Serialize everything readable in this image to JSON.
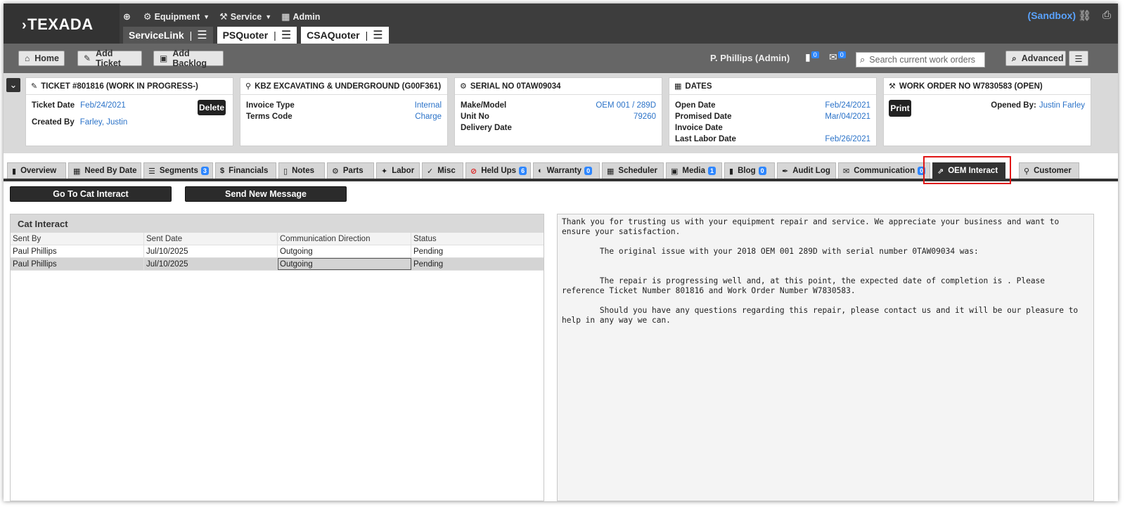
{
  "app": {
    "logo": "TEXADA",
    "topmenu": {
      "equipment": "Equipment",
      "service": "Service",
      "admin": "Admin"
    },
    "app_tabs": [
      {
        "label": "ServiceLink"
      },
      {
        "label": "PSQuoter"
      },
      {
        "label": "CSAQuoter"
      }
    ],
    "sandbox": "(Sandbox)"
  },
  "toolbar": {
    "home": "Home",
    "add_ticket": "Add Ticket",
    "add_backlog": "Add Backlog",
    "user": "P. Phillips (Admin)",
    "badge1": "0",
    "badge2": "0",
    "search_placeholder": "Search current work orders",
    "advanced": "Advanced"
  },
  "ticket": {
    "title": "TICKET #801816 (WORK IN PROGRESS-)",
    "ticket_date_label": "Ticket Date",
    "ticket_date": "Feb/24/2021",
    "created_by_label": "Created By",
    "created_by": "Farley, Justin",
    "delete": "Delete"
  },
  "customer": {
    "title": "KBZ EXCAVATING & UNDERGROUND (G00F361)",
    "invoice_type_label": "Invoice Type",
    "invoice_type": "Internal",
    "terms_code_label": "Terms Code",
    "terms_code": "Charge"
  },
  "serial": {
    "title": "SERIAL NO 0TAW09034",
    "make_model_label": "Make/Model",
    "make_model": "OEM 001 / 289D",
    "unit_no_label": "Unit No",
    "unit_no": "79260",
    "delivery_date_label": "Delivery Date"
  },
  "dates": {
    "title": "DATES",
    "open_date_label": "Open Date",
    "open_date": "Feb/24/2021",
    "promised_date_label": "Promised Date",
    "promised_date": "Mar/04/2021",
    "invoice_date_label": "Invoice Date",
    "last_labor_date_label": "Last Labor Date",
    "last_labor_date": "Feb/26/2021"
  },
  "work_order": {
    "title": "WORK ORDER NO W7830583 (OPEN)",
    "print": "Print",
    "opened_by_label": "Opened By:",
    "opened_by": "Justin Farley"
  },
  "tabs": [
    {
      "label": "Overview"
    },
    {
      "label": "Need By Date"
    },
    {
      "label": "Segments",
      "badge": "3"
    },
    {
      "label": "Financials"
    },
    {
      "label": "Notes"
    },
    {
      "label": "Parts"
    },
    {
      "label": "Labor"
    },
    {
      "label": "Misc"
    },
    {
      "label": "Held Ups",
      "badge": "6"
    },
    {
      "label": "Warranty",
      "badge": "0"
    },
    {
      "label": "Scheduler"
    },
    {
      "label": "Media",
      "badge": "1"
    },
    {
      "label": "Blog",
      "badge": "0"
    },
    {
      "label": "Audit Log"
    },
    {
      "label": "Communication",
      "badge": "0"
    },
    {
      "label": "OEM Interact"
    },
    {
      "label": "Customer"
    }
  ],
  "actions": {
    "go_to_cat": "Go To Cat Interact",
    "send_message": "Send New Message"
  },
  "grid": {
    "title": "Cat Interact",
    "columns": [
      "Sent By",
      "Sent Date",
      "Communication Direction",
      "Status"
    ],
    "rows": [
      [
        "Paul Phillips",
        "Jul/10/2025",
        "Outgoing",
        "Pending"
      ],
      [
        "Paul Phillips",
        "Jul/10/2025",
        "Outgoing",
        "Pending"
      ]
    ]
  },
  "message": {
    "p1": "Thank you for trusting us with your equipment repair and service. We appreciate your business and want to ensure your satisfaction.",
    "p2": "        The original issue with your 2018 OEM 001 289D with serial number 0TAW09034 was:",
    "p3": "        The repair is progressing well and, at this point, the expected date of completion is . Please reference Ticket Number 801816 and Work Order Number W7830583.",
    "p4": "        Should you have any questions regarding this repair, please contact us and it will be our pleasure to help in any way we can."
  },
  "colors": {
    "link_blue": "#2a72c8",
    "badge_blue": "#2d86ff",
    "highlight_red": "#e01616",
    "header_dark": "#3d3d3d"
  }
}
